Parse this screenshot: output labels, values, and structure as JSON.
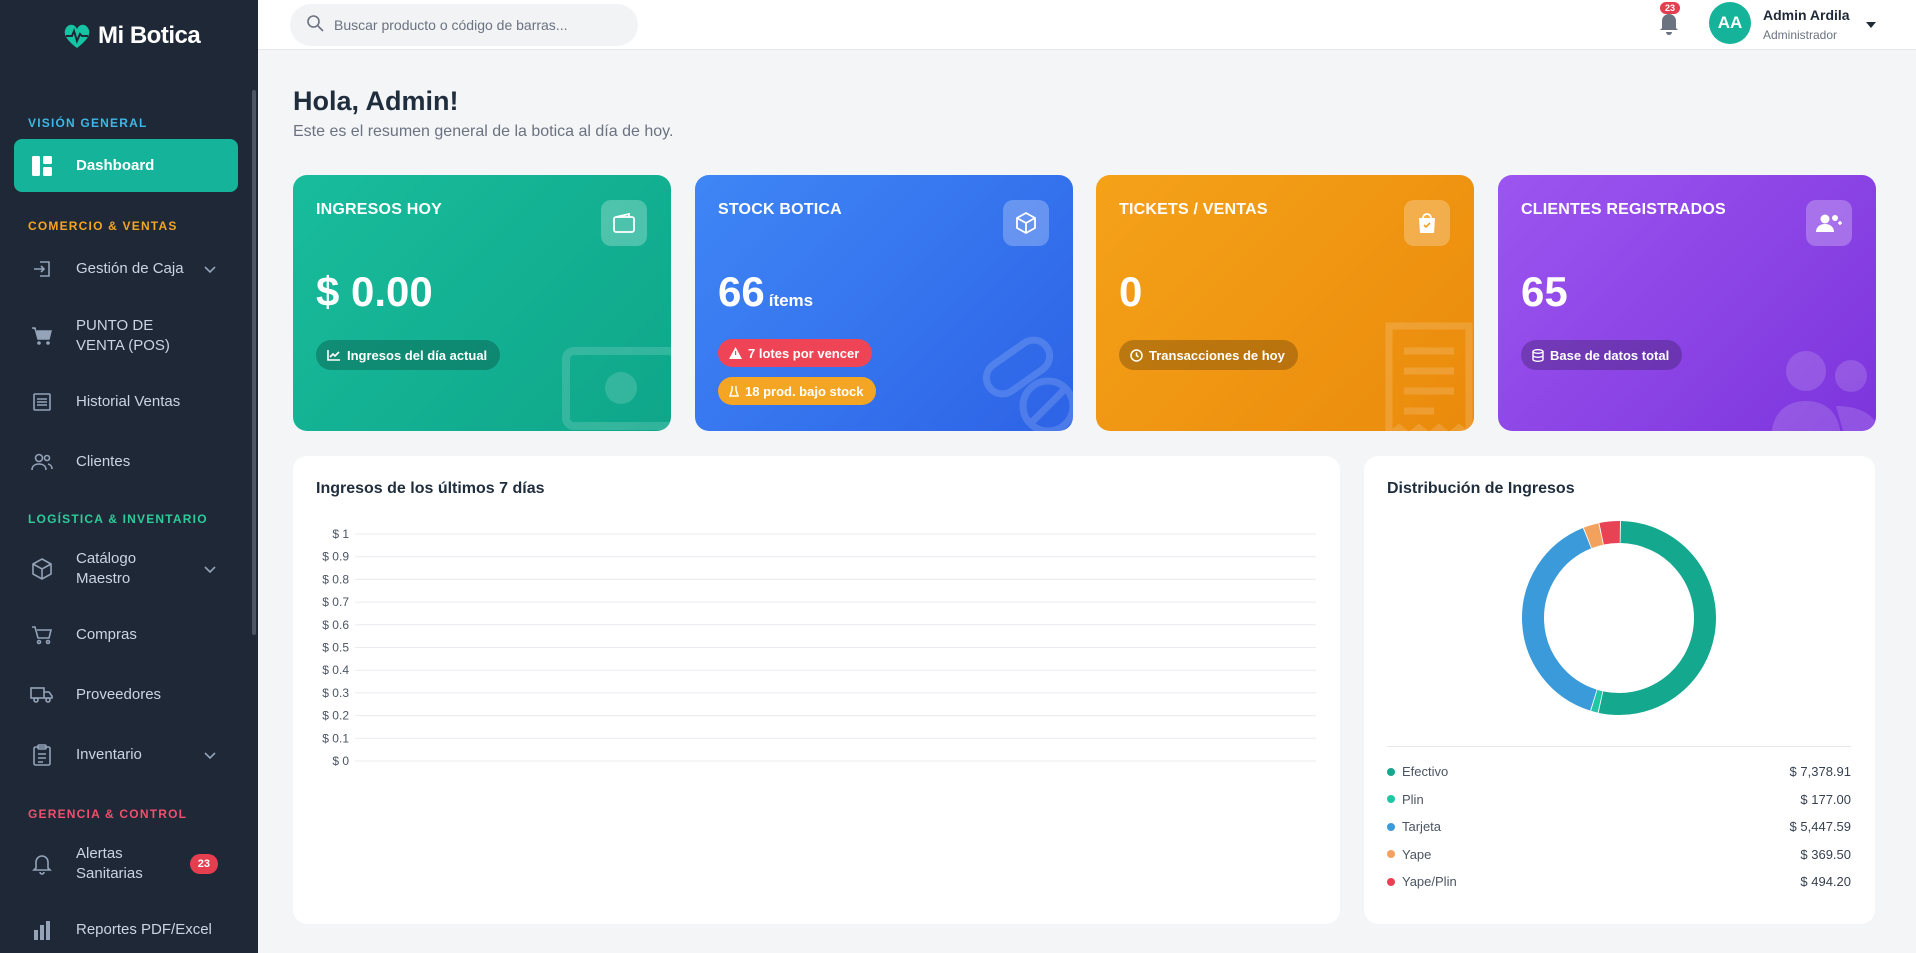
{
  "brand": {
    "name": "Mi Botica"
  },
  "sidebar": {
    "sections": {
      "general": {
        "label": "VISIÓN GENERAL",
        "color": "#3db8e6"
      },
      "commerce": {
        "label": "COMERCIO & VENTAS",
        "color": "#f5a524"
      },
      "logistics": {
        "label": "LOGÍSTICA & INVENTARIO",
        "color": "#2ecc9a"
      },
      "management": {
        "label": "GERENCIA & CONTROL",
        "color": "#f0506e"
      }
    },
    "items": {
      "dashboard": "Dashboard",
      "cash": "Gestión de Caja",
      "pos": "PUNTO DE VENTA (POS)",
      "history": "Historial Ventas",
      "clients": "Clientes",
      "catalog": "Catálogo Maestro",
      "purchases": "Compras",
      "suppliers": "Proveedores",
      "inventory": "Inventario",
      "alerts": "Alertas Sanitarias",
      "alerts_badge": "23",
      "reports": "Reportes PDF/Excel"
    }
  },
  "topbar": {
    "search_placeholder": "Buscar producto o código de barras...",
    "notifications": "23",
    "avatar_initials": "AA",
    "user_name": "Admin Ardila",
    "user_role": "Administrador"
  },
  "header": {
    "greeting": "Hola, Admin!",
    "subtitle": "Este es el resumen general de la botica al día de hoy."
  },
  "cards": [
    {
      "title": "INGRESOS HOY",
      "value": "$ 0.00",
      "pill": "Ingresos del día actual",
      "color": "#15b495"
    },
    {
      "title": "STOCK BOTICA",
      "value": "66",
      "unit": "ítems",
      "pill": "7 lotes por vencer",
      "pill2": "18 prod. bajo stock",
      "color": "#3b76ef"
    },
    {
      "title": "TICKETS / VENTAS",
      "value": "0",
      "pill": "Transacciones de hoy",
      "color": "#f39a12"
    },
    {
      "title": "CLIENTES REGISTRADOS",
      "value": "65",
      "pill": "Base de datos total",
      "color": "#8b45e8"
    }
  ],
  "charts": {
    "income_title": "Ingresos de los últimos 7 días",
    "distribution_title": "Distribución de Ingresos"
  },
  "chart_data": [
    {
      "type": "line",
      "title": "Ingresos de los últimos 7 días",
      "ylim": [
        0,
        1
      ],
      "yticks": [
        "$ 1",
        "$ 0.9",
        "$ 0.8",
        "$ 0.7",
        "$ 0.6",
        "$ 0.5",
        "$ 0.4",
        "$ 0.3",
        "$ 0.2",
        "$ 0.1",
        "$ 0"
      ],
      "series": []
    },
    {
      "type": "pie",
      "title": "Distribución de Ingresos",
      "labels": [
        "Efectivo",
        "Plin",
        "Tarjeta",
        "Yape",
        "Yape/Plin"
      ],
      "values": [
        7378.91,
        177.0,
        5447.59,
        369.5,
        494.2
      ],
      "display_values": [
        "$ 7,378.91",
        "$ 177.00",
        "$ 5,447.59",
        "$ 369.50",
        "$ 494.20"
      ],
      "colors": [
        "#14a88f",
        "#1fc7a4",
        "#3b9ad9",
        "#f2a25c",
        "#e84355"
      ]
    }
  ]
}
